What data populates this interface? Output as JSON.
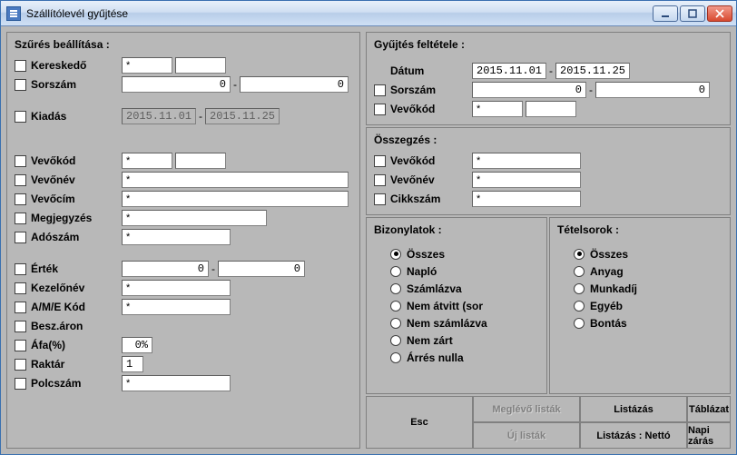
{
  "window": {
    "title": "Szállítólevél gyűjtése"
  },
  "filter": {
    "title": "Szűrés beállítása :",
    "kereskedo": {
      "label": "Kereskedő",
      "v1": "*",
      "v2": ""
    },
    "sorszam": {
      "label": "Sorszám",
      "v1": "0",
      "v2": "0"
    },
    "kiadas": {
      "label": "Kiadás",
      "v1": "2015.11.01",
      "v2": "2015.11.25"
    },
    "vevokod": {
      "label": "Vevőkód",
      "v1": "*",
      "v2": ""
    },
    "vevonev": {
      "label": "Vevőnév",
      "v": "*"
    },
    "vevocim": {
      "label": "Vevőcím",
      "v": "*"
    },
    "megjegyzes": {
      "label": "Megjegyzés",
      "v": "*"
    },
    "adoszam": {
      "label": "Adószám",
      "v": "*"
    },
    "ertek": {
      "label": "Érték",
      "v1": "0",
      "v2": "0"
    },
    "kezelonev": {
      "label": "Kezelőnév",
      "v": "*"
    },
    "amekod": {
      "label": "A/M/E Kód",
      "v": "*"
    },
    "beszaron": {
      "label": "Besz.áron"
    },
    "afa": {
      "label": "Áfa(%)",
      "v": "0%"
    },
    "raktar": {
      "label": "Raktár",
      "v": "1"
    },
    "polcszam": {
      "label": "Polcszám",
      "v": "*"
    }
  },
  "cond": {
    "title": "Gyűjtés feltétele :",
    "datum": {
      "label": "Dátum",
      "v1": "2015.11.01",
      "v2": "2015.11.25"
    },
    "sorszam": {
      "label": "Sorszám",
      "v1": "0",
      "v2": "0"
    },
    "vevokod": {
      "label": "Vevőkód",
      "v1": "*",
      "v2": ""
    }
  },
  "summary": {
    "title": "Összegzés :",
    "vevokod": {
      "label": "Vevőkód",
      "v": "*"
    },
    "vevonev": {
      "label": "Vevőnév",
      "v": "*"
    },
    "cikkszam": {
      "label": "Cikkszám",
      "v": "*"
    }
  },
  "bizonylatok": {
    "title": "Bizonylatok :",
    "options": [
      "Összes",
      "Napló",
      "Számlázva",
      "Nem átvitt (sor",
      "Nem számlázva",
      "Nem zárt",
      "Árrés nulla"
    ],
    "selected": 0
  },
  "tetelsorok": {
    "title": "Tételsorok :",
    "options": [
      "Összes",
      "Anyag",
      "Munkadíj",
      "Egyéb",
      "Bontás"
    ],
    "selected": 0
  },
  "buttons": {
    "meglevo": "Meglévő listák",
    "listazas": "Listázás",
    "tablazat": "Táblázat",
    "ujlistak": "Új listák",
    "listnetto": "Listázás : Nettó",
    "napizaras": "Napi zárás",
    "esc": "Esc"
  }
}
